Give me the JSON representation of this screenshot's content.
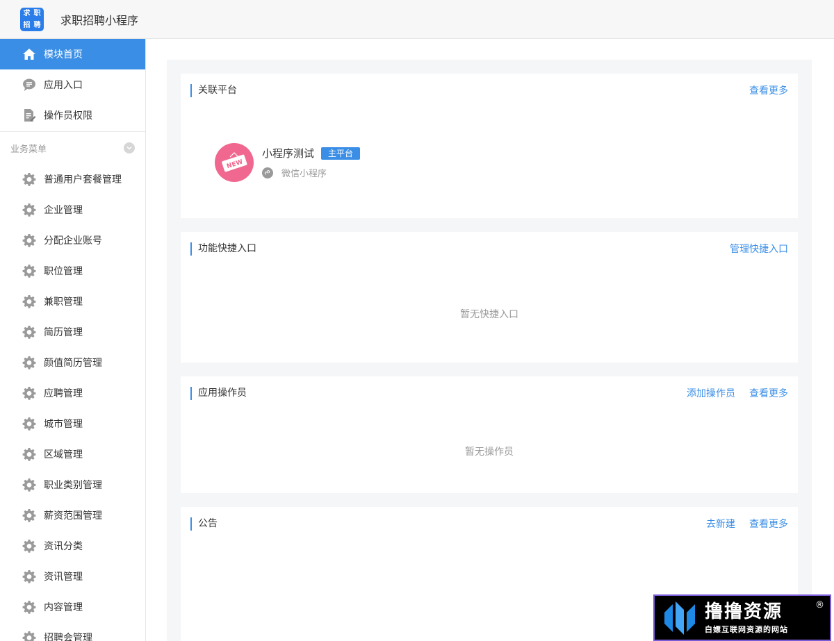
{
  "app": {
    "logo_chars": [
      "求",
      "职",
      "招",
      "聘"
    ],
    "title": "求职招聘小程序"
  },
  "sidebar": {
    "top_items": [
      {
        "label": "模块首页",
        "icon": "home-icon",
        "active": true
      },
      {
        "label": "应用入口",
        "icon": "chat-icon",
        "active": false
      },
      {
        "label": "操作员权限",
        "icon": "document-edit-icon",
        "active": false
      }
    ],
    "section_title": "业务菜单",
    "section_items": [
      {
        "label": "普通用户套餐管理"
      },
      {
        "label": "企业管理"
      },
      {
        "label": "分配企业账号"
      },
      {
        "label": "职位管理"
      },
      {
        "label": "兼职管理"
      },
      {
        "label": "简历管理"
      },
      {
        "label": "颜值简历管理"
      },
      {
        "label": "应聘管理"
      },
      {
        "label": "城市管理"
      },
      {
        "label": "区域管理"
      },
      {
        "label": "职业类别管理"
      },
      {
        "label": "薪资范围管理"
      },
      {
        "label": "资讯分类"
      },
      {
        "label": "资讯管理"
      },
      {
        "label": "内容管理"
      },
      {
        "label": "招聘会管理"
      }
    ]
  },
  "cards": {
    "platform": {
      "title": "关联平台",
      "more_link": "查看更多",
      "name": "小程序测试",
      "badge": "主平台",
      "type": "微信小程序",
      "avatar_text": "NEW"
    },
    "shortcuts": {
      "title": "功能快捷入口",
      "manage_link": "管理快捷入口",
      "empty": "暂无快捷入口"
    },
    "operators": {
      "title": "应用操作员",
      "add_link": "添加操作员",
      "more_link": "查看更多",
      "empty": "暂无操作员"
    },
    "notice": {
      "title": "公告",
      "new_link": "去新建",
      "more_link": "查看更多"
    }
  },
  "watermark": {
    "title": "撸撸资源",
    "subtitle": "白嫖互联网资源的网站",
    "reg": "®"
  },
  "colors": {
    "accent": "#3a8ee6",
    "avatar_pink": "#f0688f"
  }
}
